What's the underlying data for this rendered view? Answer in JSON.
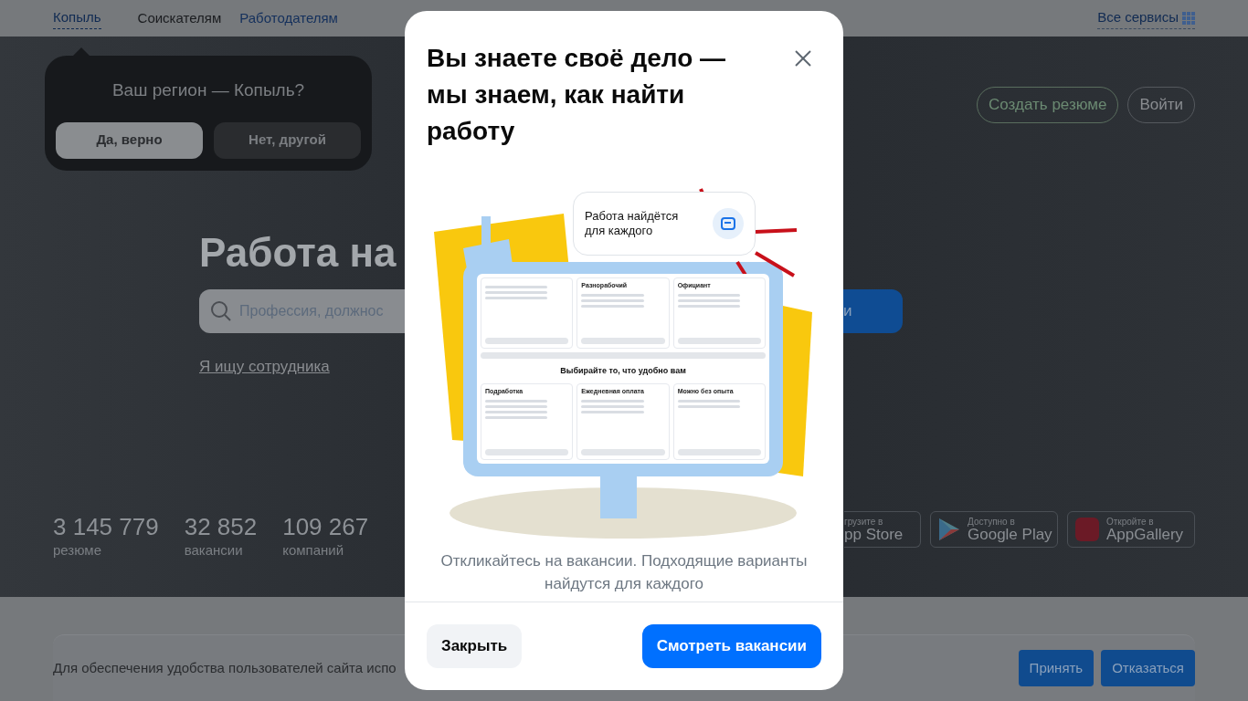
{
  "header": {
    "nav": [
      {
        "label": "Копыль",
        "kind": "region"
      },
      {
        "label": "Соискателям",
        "kind": "section",
        "selected": true
      },
      {
        "label": "Работодателям",
        "kind": "section",
        "selected": false
      }
    ],
    "services": "Все сервисы"
  },
  "region_popup": {
    "question": "Ваш регион — Копыль?",
    "buttons": [
      {
        "label": "Да, верно",
        "primary": true
      },
      {
        "label": "Нет, другой",
        "primary": false
      }
    ]
  },
  "hero": {
    "actions": [
      {
        "label": "Создать резюме",
        "kind": "accent"
      },
      {
        "label": "Войти",
        "kind": "plain"
      }
    ],
    "title": "Работа на",
    "search": {
      "placeholder": "Профессия, должнос",
      "button": "и"
    },
    "employer_link": "Я ищу сотрудника",
    "stats": [
      {
        "value": "3 145 779",
        "label": "резюме"
      },
      {
        "value": "32 852",
        "label": "вакансии"
      },
      {
        "value": "109 267",
        "label": "компаний"
      }
    ],
    "app_badges": [
      {
        "kind": "appstore",
        "caption": "грузите в",
        "store": "pp Store"
      },
      {
        "kind": "googleplay",
        "caption": "Доступно в",
        "store": "Google Play"
      },
      {
        "kind": "appgallery",
        "caption": "Откройте в",
        "store": "AppGallery"
      }
    ]
  },
  "cookie_bar": {
    "text": "Для обеспечения удобства пользователей сайта испо",
    "buttons": [
      "Принять",
      "Отказаться"
    ]
  },
  "modal": {
    "title": "Вы знаете своё дело — мы знаем, как найти работу",
    "illustration": {
      "bubble": "Работа найдётся для каждого",
      "top_cards": [
        "Разнорабочий",
        "Официант"
      ],
      "heading": "Выбирайте то, что удобно вам",
      "bottom_cards": [
        "Подработка",
        "Ежедневная оплата",
        "Можно без опыта"
      ]
    },
    "text": "Откликайтесь на вакансии. Подходящие варианты найдутся для каждого",
    "buttons": [
      {
        "label": "Закрыть",
        "kind": "secondary"
      },
      {
        "label": "Смотреть вакансии",
        "kind": "primary"
      }
    ]
  }
}
